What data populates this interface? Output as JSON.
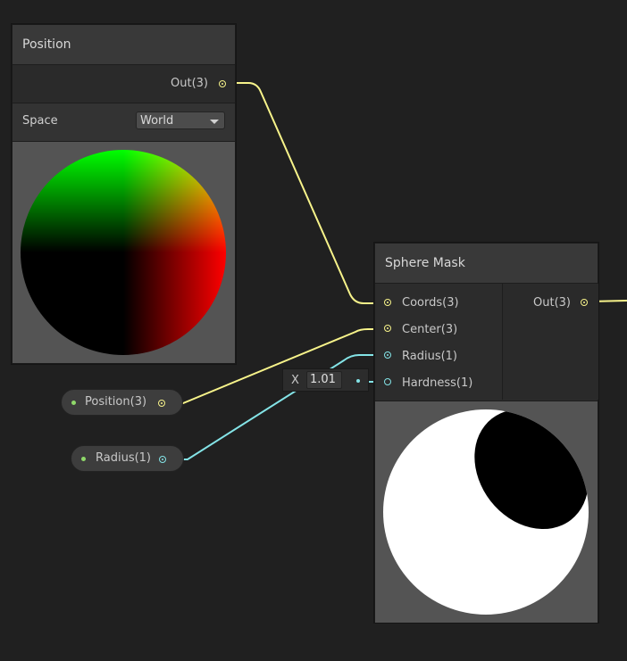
{
  "colors": {
    "background": "#202020",
    "vector3_wire": "#f7f38a",
    "float_wire": "#84e4e7",
    "property_dot": "#8fd96a"
  },
  "position_node": {
    "title": "Position",
    "output_label": "Out(3)",
    "space_label": "Space",
    "space_value": "World",
    "preview_icon": "position-gradient-sphere"
  },
  "sphere_mask_node": {
    "title": "Sphere Mask",
    "inputs": [
      "Coords(3)",
      "Center(3)",
      "Radius(1)",
      "Hardness(1)"
    ],
    "output_label": "Out(3)",
    "preview_icon": "sphere-mask-preview"
  },
  "properties": [
    {
      "label": "Position(3)"
    },
    {
      "label": "Radius(1)"
    }
  ],
  "hardness_field": {
    "axis": "X",
    "value": "1.01"
  }
}
